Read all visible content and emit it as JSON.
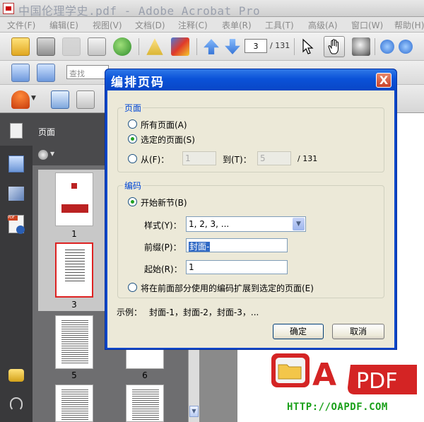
{
  "window": {
    "title": "中国伦理学史.pdf - Adobe Acrobat Pro"
  },
  "menu": [
    "文件(F)",
    "编辑(E)",
    "视图(V)",
    "文档(D)",
    "注释(C)",
    "表单(R)",
    "工具(T)",
    "高级(A)",
    "窗口(W)",
    "帮助(H)"
  ],
  "toolbar": {
    "current_page": "3",
    "total_pages": "/ 131",
    "find_placeholder": "查找"
  },
  "nav_panel": {
    "title": "页面",
    "thumbnails": [
      {
        "label": "1"
      },
      {
        "label": "3"
      },
      {
        "label": "5"
      },
      {
        "label": "6"
      }
    ]
  },
  "dialog": {
    "title": "编排页码",
    "close_label": "X",
    "pages_group": {
      "title": "页面",
      "all_pages": "所有页面(A)",
      "selected_pages": "选定的页面(S)",
      "from_label": "从(F)：",
      "from_value": "1",
      "to_label": "到(T)：",
      "to_value": "5",
      "total": "/ 131"
    },
    "numbering_group": {
      "title": "编码",
      "begin_new_section": "开始新节(B)",
      "style_label": "样式(Y)：",
      "style_value": "1, 2, 3, ...",
      "prefix_label": "前缀(P)：",
      "prefix_value": "封面-",
      "start_label": "起始(R)：",
      "start_value": "1",
      "extend_label": "将在前面部分使用的编码扩展到选定的页面(E)"
    },
    "example_label": "示例：",
    "example_value": "封面-1，封面-2，封面-3，...",
    "ok_label": "确定",
    "cancel_label": "取消"
  },
  "watermark": {
    "letter": "A",
    "pdf": "PDF",
    "url": "HTTP://OAPDF.COM"
  },
  "colors": {
    "dialog_title_blue": "#0b52d8",
    "group_title_blue": "#0046d5",
    "radio_green": "#21a121",
    "url_green": "#1aa01a",
    "logo_red": "#d42424"
  }
}
